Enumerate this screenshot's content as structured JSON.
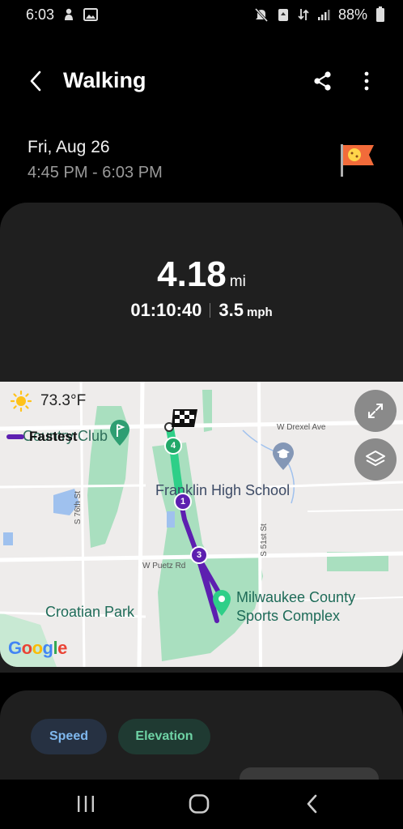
{
  "status_bar": {
    "time": "6:03",
    "battery_percent": "88%",
    "icons": [
      "notification-icon",
      "gallery-icon",
      "mute-icon",
      "recycle-icon",
      "data-icon",
      "signal-icon",
      "battery-icon"
    ]
  },
  "header": {
    "title": "Walking"
  },
  "session": {
    "date": "Fri, Aug 26",
    "time_range": "4:45 PM - 6:03 PM"
  },
  "stats": {
    "distance_value": "4.18",
    "distance_unit": "mi",
    "duration": "01:10:40",
    "speed_value": "3.5",
    "speed_unit": "mph"
  },
  "map": {
    "weather_temp": "73.3°F",
    "legend_label": "Fastest",
    "labels": {
      "country_club": "Country Club",
      "high_school": "Franklin High School",
      "park": "Croatian Park",
      "sports_complex_line1": "Milwaukee County",
      "sports_complex_line2": "Sports Complex",
      "drexel": "W Drexel Ave",
      "puetz": "W Puetz Rd",
      "st76": "S 76th St",
      "st51": "S 51st St"
    },
    "markers": [
      "1",
      "3",
      "4"
    ],
    "attribution": "Google",
    "colors": {
      "route_fast": "#5d1fb0",
      "route_normal": "#2ecf88",
      "park": "#a9dfbf"
    }
  },
  "tabs": {
    "speed": "Speed",
    "elevation": "Elevation"
  }
}
